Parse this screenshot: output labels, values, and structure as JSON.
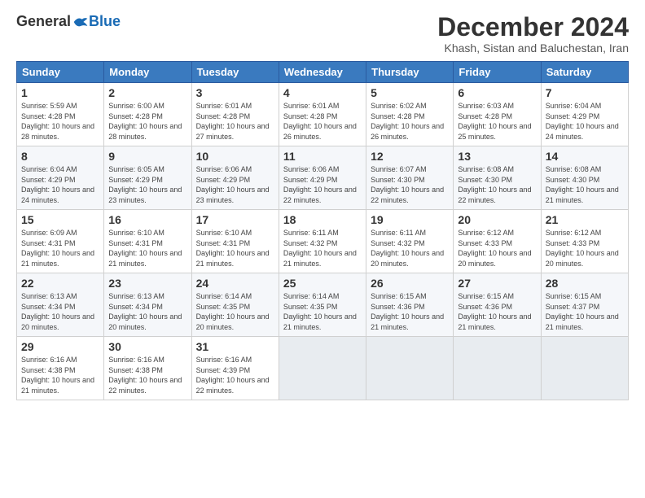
{
  "header": {
    "logo_general": "General",
    "logo_blue": "Blue",
    "month_title": "December 2024",
    "subtitle": "Khash, Sistan and Baluchestan, Iran"
  },
  "weekdays": [
    "Sunday",
    "Monday",
    "Tuesday",
    "Wednesday",
    "Thursday",
    "Friday",
    "Saturday"
  ],
  "weeks": [
    [
      {
        "day": "1",
        "sunrise": "5:59 AM",
        "sunset": "4:28 PM",
        "daylight": "10 hours and 28 minutes."
      },
      {
        "day": "2",
        "sunrise": "6:00 AM",
        "sunset": "4:28 PM",
        "daylight": "10 hours and 28 minutes."
      },
      {
        "day": "3",
        "sunrise": "6:01 AM",
        "sunset": "4:28 PM",
        "daylight": "10 hours and 27 minutes."
      },
      {
        "day": "4",
        "sunrise": "6:01 AM",
        "sunset": "4:28 PM",
        "daylight": "10 hours and 26 minutes."
      },
      {
        "day": "5",
        "sunrise": "6:02 AM",
        "sunset": "4:28 PM",
        "daylight": "10 hours and 26 minutes."
      },
      {
        "day": "6",
        "sunrise": "6:03 AM",
        "sunset": "4:28 PM",
        "daylight": "10 hours and 25 minutes."
      },
      {
        "day": "7",
        "sunrise": "6:04 AM",
        "sunset": "4:29 PM",
        "daylight": "10 hours and 24 minutes."
      }
    ],
    [
      {
        "day": "8",
        "sunrise": "6:04 AM",
        "sunset": "4:29 PM",
        "daylight": "10 hours and 24 minutes."
      },
      {
        "day": "9",
        "sunrise": "6:05 AM",
        "sunset": "4:29 PM",
        "daylight": "10 hours and 23 minutes."
      },
      {
        "day": "10",
        "sunrise": "6:06 AM",
        "sunset": "4:29 PM",
        "daylight": "10 hours and 23 minutes."
      },
      {
        "day": "11",
        "sunrise": "6:06 AM",
        "sunset": "4:29 PM",
        "daylight": "10 hours and 22 minutes."
      },
      {
        "day": "12",
        "sunrise": "6:07 AM",
        "sunset": "4:30 PM",
        "daylight": "10 hours and 22 minutes."
      },
      {
        "day": "13",
        "sunrise": "6:08 AM",
        "sunset": "4:30 PM",
        "daylight": "10 hours and 22 minutes."
      },
      {
        "day": "14",
        "sunrise": "6:08 AM",
        "sunset": "4:30 PM",
        "daylight": "10 hours and 21 minutes."
      }
    ],
    [
      {
        "day": "15",
        "sunrise": "6:09 AM",
        "sunset": "4:31 PM",
        "daylight": "10 hours and 21 minutes."
      },
      {
        "day": "16",
        "sunrise": "6:10 AM",
        "sunset": "4:31 PM",
        "daylight": "10 hours and 21 minutes."
      },
      {
        "day": "17",
        "sunrise": "6:10 AM",
        "sunset": "4:31 PM",
        "daylight": "10 hours and 21 minutes."
      },
      {
        "day": "18",
        "sunrise": "6:11 AM",
        "sunset": "4:32 PM",
        "daylight": "10 hours and 21 minutes."
      },
      {
        "day": "19",
        "sunrise": "6:11 AM",
        "sunset": "4:32 PM",
        "daylight": "10 hours and 20 minutes."
      },
      {
        "day": "20",
        "sunrise": "6:12 AM",
        "sunset": "4:33 PM",
        "daylight": "10 hours and 20 minutes."
      },
      {
        "day": "21",
        "sunrise": "6:12 AM",
        "sunset": "4:33 PM",
        "daylight": "10 hours and 20 minutes."
      }
    ],
    [
      {
        "day": "22",
        "sunrise": "6:13 AM",
        "sunset": "4:34 PM",
        "daylight": "10 hours and 20 minutes."
      },
      {
        "day": "23",
        "sunrise": "6:13 AM",
        "sunset": "4:34 PM",
        "daylight": "10 hours and 20 minutes."
      },
      {
        "day": "24",
        "sunrise": "6:14 AM",
        "sunset": "4:35 PM",
        "daylight": "10 hours and 20 minutes."
      },
      {
        "day": "25",
        "sunrise": "6:14 AM",
        "sunset": "4:35 PM",
        "daylight": "10 hours and 21 minutes."
      },
      {
        "day": "26",
        "sunrise": "6:15 AM",
        "sunset": "4:36 PM",
        "daylight": "10 hours and 21 minutes."
      },
      {
        "day": "27",
        "sunrise": "6:15 AM",
        "sunset": "4:36 PM",
        "daylight": "10 hours and 21 minutes."
      },
      {
        "day": "28",
        "sunrise": "6:15 AM",
        "sunset": "4:37 PM",
        "daylight": "10 hours and 21 minutes."
      }
    ],
    [
      {
        "day": "29",
        "sunrise": "6:16 AM",
        "sunset": "4:38 PM",
        "daylight": "10 hours and 21 minutes."
      },
      {
        "day": "30",
        "sunrise": "6:16 AM",
        "sunset": "4:38 PM",
        "daylight": "10 hours and 22 minutes."
      },
      {
        "day": "31",
        "sunrise": "6:16 AM",
        "sunset": "4:39 PM",
        "daylight": "10 hours and 22 minutes."
      },
      null,
      null,
      null,
      null
    ]
  ]
}
